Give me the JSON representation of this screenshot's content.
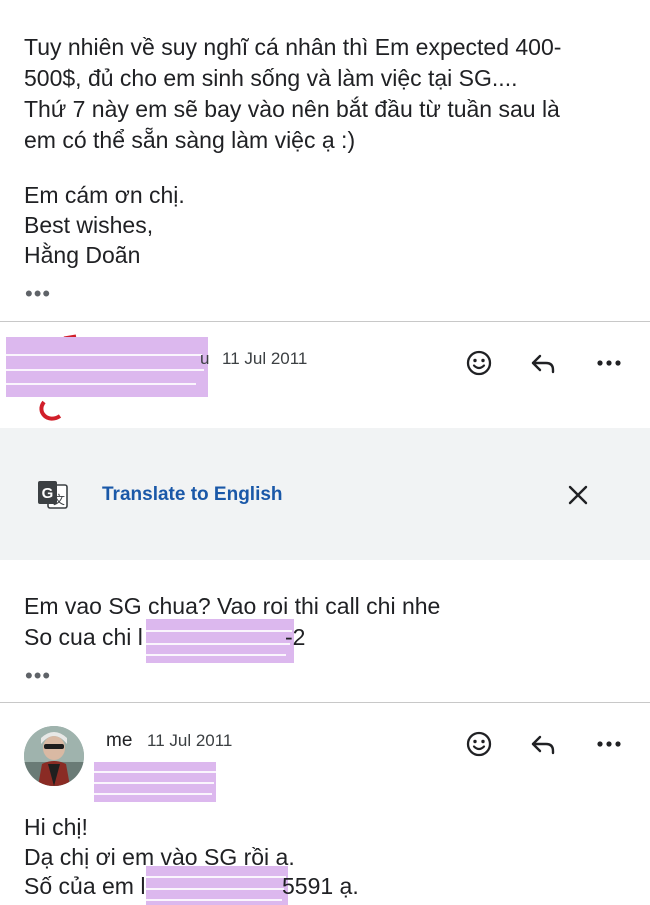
{
  "message1": {
    "lines": [
      "Tuy nhiên về suy nghĩ cá nhân thì Em expected 400-",
      "500$,  đủ cho em sinh sống và làm việc tại SG....",
      "Thứ 7 này em sẽ bay vào nên bắt đầu từ tuần sau là",
      "em có thể sẵn sàng làm việc ạ :)",
      "Em cám ơn chị.",
      "Best wishes,",
      "Hằng Doãn"
    ],
    "more": "•••"
  },
  "message2": {
    "sender_fragment": "u",
    "date": "11 Jul 2011",
    "body": {
      "line1": "Em vao SG chua? Vao roi thi call chi nhe",
      "line2_prefix": "So cua chi l",
      "line2_suffix": "-2"
    },
    "more": "•••"
  },
  "translate": {
    "label": "Translate to English",
    "icon": "google-translate-icon",
    "close_icon": "close-icon"
  },
  "message3": {
    "sender": "me",
    "date": "11 Jul 2011",
    "body": {
      "line1": "Hi chị!",
      "line2": "Dạ chị ơi em vào SG rồi ạ.",
      "line3_prefix": "Số của em l",
      "line3_suffix": "5591 ạ."
    }
  },
  "actions": {
    "react_icon": "smiley-icon",
    "reply_icon": "reply-icon",
    "more_icon": "more-horizontal-icon"
  },
  "colors": {
    "link": "#1a58a8",
    "redaction": "#dcb8ee",
    "translate_bg": "#f1f3f4",
    "divider": "#c8c8c8"
  }
}
